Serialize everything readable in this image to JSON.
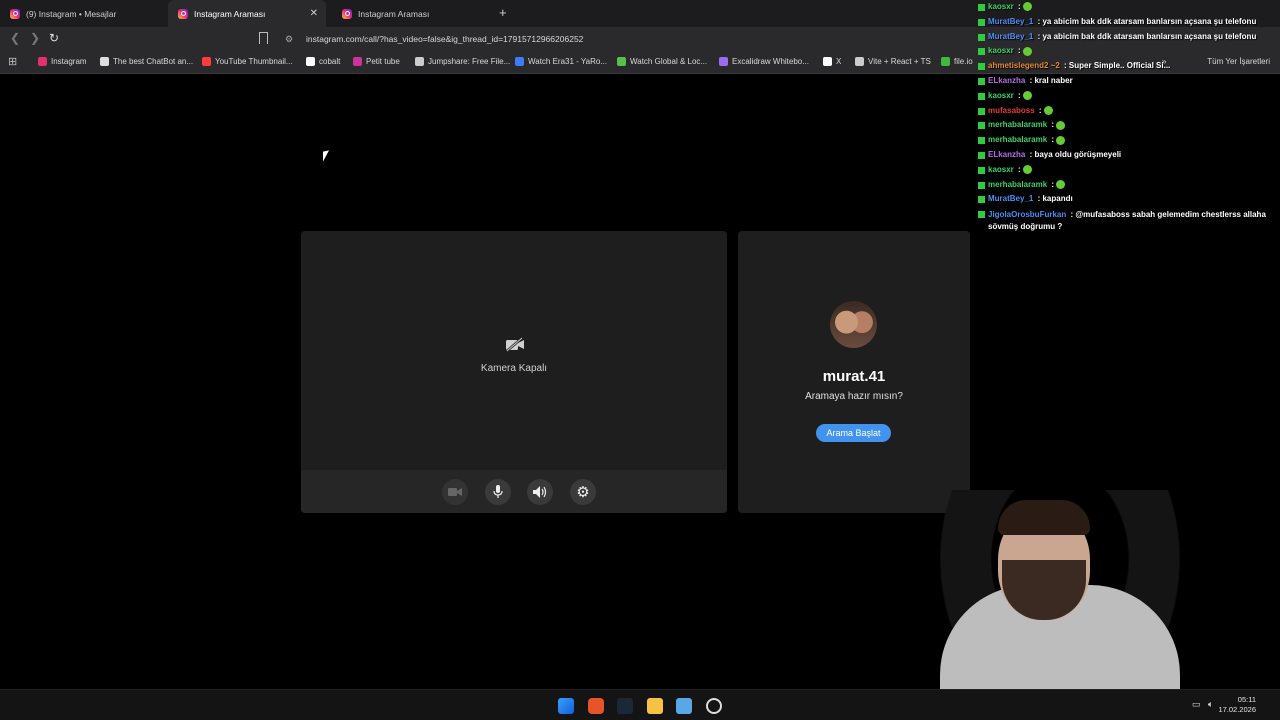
{
  "browser": {
    "tabs": [
      {
        "label": "(9) Instagram • Mesajlar"
      },
      {
        "label": "Instagram Araması"
      },
      {
        "label": "Instagram Araması"
      }
    ],
    "new_tab_icon": "plus-icon",
    "url": "instagram.com/call/?has_video=false&ig_thread_id=17915712966206252",
    "bookmarks": [
      {
        "label": "Instagram",
        "color": "#e1306c"
      },
      {
        "label": "The best ChatBot an...",
        "color": "#dddddd"
      },
      {
        "label": "YouTube Thumbnail...",
        "color": "#ff3b3b"
      },
      {
        "label": "cobalt",
        "color": "#ffffff"
      },
      {
        "label": "Petit tube",
        "color": "#cc3399"
      },
      {
        "label": "Jumpshare: Free File...",
        "color": "#cccccc"
      },
      {
        "label": "Watch Era31 - YaRo...",
        "color": "#3d7cf5"
      },
      {
        "label": "Watch Global & Loc...",
        "color": "#57c04a"
      },
      {
        "label": "Excalidraw Whitebo...",
        "color": "#9b6bf0"
      },
      {
        "label": "X",
        "color": "#ffffff"
      },
      {
        "label": "Vite + React + TS",
        "color": "#cccccc"
      },
      {
        "label": "file.io",
        "color": "#3dbb3d"
      }
    ],
    "all_bookmarks": "Tüm Yer İşaretleri"
  },
  "chat": {
    "messages": [
      {
        "user": "kaosxr",
        "user_color": "#3cd06a",
        "text": " :"
      },
      {
        "user": "MuratBey_1",
        "user_color": "#4d8ef5",
        "text": " : ya abicim bak ddk atarsam banlarsın açsana şu telefonu"
      },
      {
        "user": "MuratBey_1",
        "user_color": "#4d8ef5",
        "text": " : ya abicim bak ddk atarsam banlarsın açsana şu telefonu"
      },
      {
        "user": "kaosxr",
        "user_color": "#3cd06a",
        "text": " :"
      },
      {
        "user": "ahmetislegend2 ~2",
        "user_color": "#e08a2e",
        "text": " : Super Simple.. Official Si..."
      },
      {
        "user": "ELkanzha",
        "user_color": "#b56ce8",
        "text": " : kral naber"
      },
      {
        "user": "kaosxr",
        "user_color": "#3cd06a",
        "text": " :"
      },
      {
        "user": "mufasaboss",
        "user_color": "#e23c3c",
        "text": " :"
      },
      {
        "user": "merhabalaramk",
        "user_color": "#3cd06a",
        "text": " :"
      },
      {
        "user": "merhabalaramk",
        "user_color": "#3cd06a",
        "text": " :"
      },
      {
        "user": "ELkanzha",
        "user_color": "#b56ce8",
        "text": " : baya oldu görüşmeyeli"
      },
      {
        "user": "kaosxr",
        "user_color": "#3cd06a",
        "text": " :"
      },
      {
        "user": "merhabalaramk",
        "user_color": "#3cd06a",
        "text": " :"
      },
      {
        "user": "MuratBey_1",
        "user_color": "#4d8ef5",
        "text": " : kapandı"
      },
      {
        "user": "JigolaOrosbuFurkan",
        "user_color": "#4d8ef5",
        "text": " : @mufasaboss sabah gelemedim chestlerss allaha sövmüş doğrumu ?"
      }
    ]
  },
  "call": {
    "camera_off_label": "Kamera Kapalı",
    "controls": [
      {
        "icon": "video-camera-icon"
      },
      {
        "icon": "microphone-icon"
      },
      {
        "icon": "speaker-icon"
      },
      {
        "icon": "gear-icon"
      }
    ],
    "username": "murat.41",
    "prompt": "Aramaya hazır mısın?",
    "start_button": "Arama Başlat",
    "accent": "#4193ef"
  },
  "taskbar": {
    "time": "05:11",
    "date": "17.02.2026"
  }
}
